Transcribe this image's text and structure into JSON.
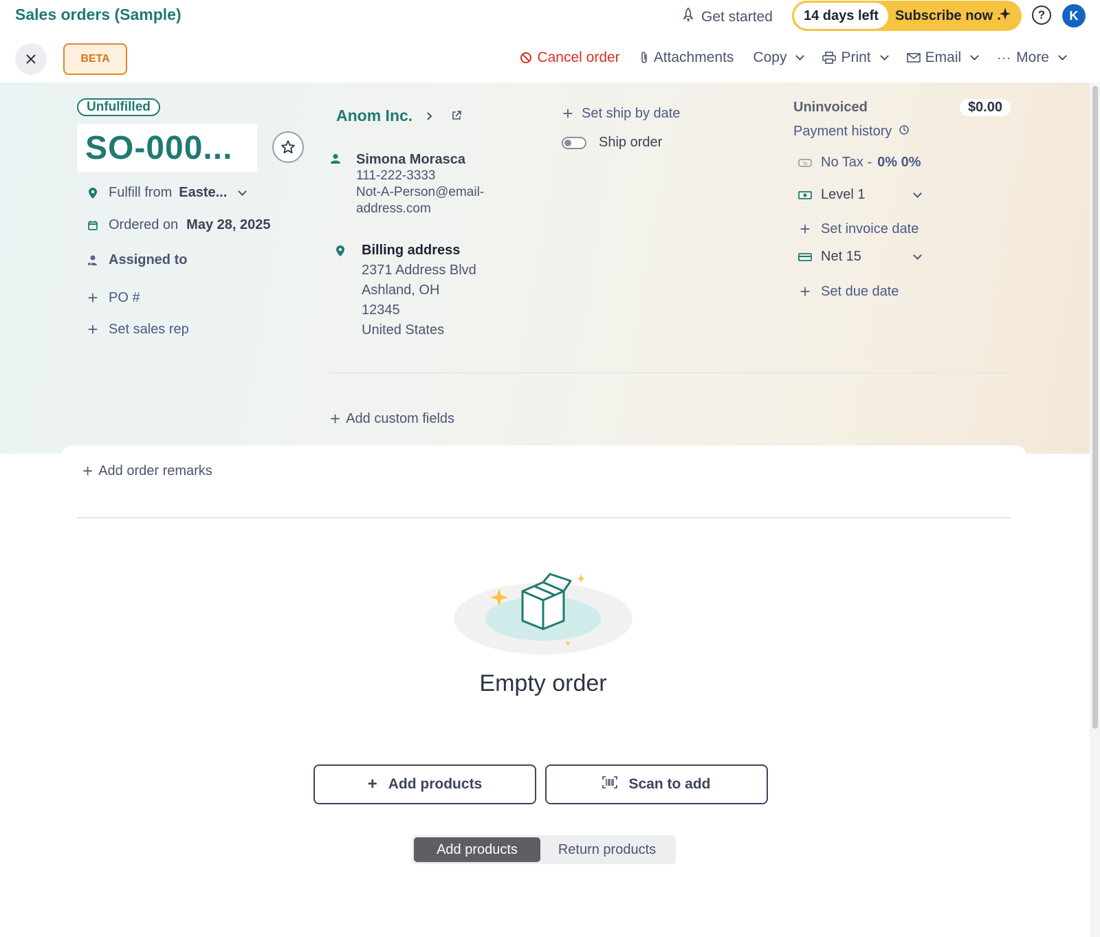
{
  "header": {
    "app_title": "Sales orders (Sample)",
    "get_started": "Get started",
    "trial_days": "14 days left",
    "subscribe": "Subscribe now",
    "help": "?",
    "avatar_initial": "K"
  },
  "toolbar": {
    "beta": "BETA",
    "cancel_order": "Cancel order",
    "attachments": "Attachments",
    "copy": "Copy",
    "print": "Print",
    "email": "Email",
    "more": "More"
  },
  "order": {
    "status": "Unfulfilled",
    "number": "SO-000...",
    "fulfill_label": "Fulfill from",
    "fulfill_value": "Easte...",
    "ordered_label": "Ordered on",
    "ordered_value": "May 28, 2025",
    "assigned_label": "Assigned to",
    "po_label": "PO #",
    "sales_rep_label": "Set sales rep"
  },
  "customer": {
    "name": "Anom Inc.",
    "contact_name": "Simona Morasca",
    "phone": "111-222-3333",
    "email_line1": "Not-A-Person@email-",
    "email_line2": "address.com",
    "billing_title": "Billing address",
    "address_line1": "2371 Address Blvd",
    "address_line2": "Ashland, OH",
    "address_line3": "12345",
    "address_line4": "United States",
    "add_custom_fields": "Add custom fields"
  },
  "shipping": {
    "ship_by": "Set ship by date",
    "ship_order": "Ship order"
  },
  "invoice": {
    "status": "Uninvoiced",
    "amount": "$0.00",
    "payment_history": "Payment history",
    "tax_label": "No Tax -",
    "tax_value": "0% 0%",
    "pricing_level": "Level 1",
    "invoice_date": "Set invoice date",
    "terms": "Net 15",
    "due_date": "Set due date"
  },
  "body": {
    "add_remarks": "Add order remarks",
    "empty_title": "Empty order",
    "add_products_btn": "Add products",
    "scan_btn": "Scan to add",
    "seg_add": "Add products",
    "seg_return": "Return products"
  },
  "colors": {
    "brand": "#1f7a73",
    "accent_yellow": "#f7c340",
    "danger": "#d93025",
    "beta_orange": "#e0862a"
  }
}
